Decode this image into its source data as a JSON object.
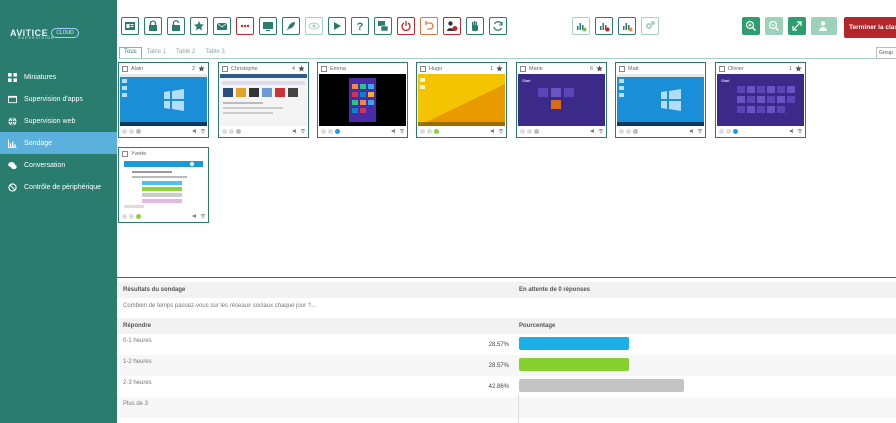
{
  "logo": {
    "name": "AViTICE",
    "sub": "SUPERVISION",
    "cloud": "CLOUD"
  },
  "sidebar": {
    "items": [
      {
        "label": "Miniatures",
        "icon": "grid-icon"
      },
      {
        "label": "Supervision d'apps",
        "icon": "monitor-icon"
      },
      {
        "label": "Supervision web",
        "icon": "globe-icon"
      },
      {
        "label": "Sondage",
        "icon": "chart-icon",
        "active": true
      },
      {
        "label": "Conversation",
        "icon": "chat-icon"
      },
      {
        "label": "Contrôle de périphérique",
        "icon": "block-icon"
      }
    ]
  },
  "toolbar": {
    "end_label": "Terminer la classe"
  },
  "tabs": [
    "Tous",
    "Table 1",
    "Table 2",
    "Table 3"
  ],
  "group_label": "Group",
  "students": [
    {
      "name": "Alain",
      "count": "2",
      "screen": "win"
    },
    {
      "name": "Christophe",
      "count": "4",
      "screen": "web"
    },
    {
      "name": "Emma",
      "count": "",
      "screen": "win8-black"
    },
    {
      "name": "Hugo",
      "count": "1",
      "screen": "yellow"
    },
    {
      "name": "Marie",
      "count": "6",
      "screen": "purple"
    },
    {
      "name": "Matt",
      "count": "",
      "screen": "win"
    },
    {
      "name": "Olivier",
      "count": "1",
      "screen": "purple-tiles"
    },
    {
      "name": "Yvette",
      "count": "",
      "screen": "form"
    }
  ],
  "results": {
    "title": "Résultats du sondage",
    "waiting": "En attente de 0 réponses",
    "question": "Combien de temps passez-vous sur les réseaux sociaux chaque jour ?...",
    "col_answer": "Répondre",
    "col_percent": "Pourcentage",
    "answers": [
      {
        "label": "0-1 heures",
        "percent": "28.57%",
        "value": 28.57,
        "color": "#1aafe6"
      },
      {
        "label": "1-2 heures",
        "percent": "28.57%",
        "value": 28.57,
        "color": "#86d12f"
      },
      {
        "label": "2-3 heures",
        "percent": "42.86%",
        "value": 42.86,
        "color": "#c4c4c4"
      },
      {
        "label": "Plus de 3",
        "percent": "",
        "value": 0,
        "color": "#c4c4c4"
      }
    ]
  }
}
